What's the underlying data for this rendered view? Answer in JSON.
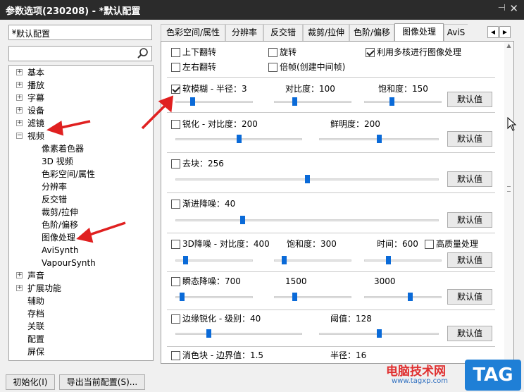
{
  "window": {
    "title": "参数选项(230208) - *默认配置"
  },
  "profile_combo": {
    "value": "*默认配置"
  },
  "tree": {
    "items": [
      {
        "label": "基本",
        "expander": "+"
      },
      {
        "label": "播放",
        "expander": "+"
      },
      {
        "label": "字幕",
        "expander": "+"
      },
      {
        "label": "设备",
        "expander": "+"
      },
      {
        "label": "滤镜",
        "expander": "+"
      },
      {
        "label": "视频",
        "expander": "−"
      },
      {
        "label": "像素着色器"
      },
      {
        "label": "3D 视频"
      },
      {
        "label": "色彩空间/属性"
      },
      {
        "label": "分辨率"
      },
      {
        "label": "反交错"
      },
      {
        "label": "裁剪/拉伸"
      },
      {
        "label": "色阶/偏移"
      },
      {
        "label": "图像处理"
      },
      {
        "label": "AviSynth"
      },
      {
        "label": "VapourSynth"
      },
      {
        "label": "声音",
        "expander": "+"
      },
      {
        "label": "扩展功能",
        "expander": "+"
      },
      {
        "label": "辅助"
      },
      {
        "label": "存档"
      },
      {
        "label": "关联"
      },
      {
        "label": "配置"
      },
      {
        "label": "屏保"
      }
    ]
  },
  "tabs": [
    {
      "label": "色彩空间/属性"
    },
    {
      "label": "分辨率"
    },
    {
      "label": "反交错"
    },
    {
      "label": "裁剪/拉伸"
    },
    {
      "label": "色阶/偏移"
    },
    {
      "label": "图像处理",
      "active": true
    },
    {
      "label": "AviS"
    }
  ],
  "top_options": {
    "flip_vertical": {
      "label": "上下翻转",
      "checked": false
    },
    "rotate": {
      "label": "旋转",
      "checked": false
    },
    "multicore": {
      "label": "利用多核进行图像处理",
      "checked": true
    },
    "flip_horizontal": {
      "label": "左右翻转",
      "checked": false
    },
    "double_frame": {
      "label": "倍帧(创建中间帧)",
      "checked": false
    }
  },
  "default_label": "默认值",
  "soft_blur": {
    "label": "软模糊 - 半径：3",
    "checked": true,
    "contrast": "对比度：100",
    "saturation": "饱和度：150",
    "radius_level": 0.2,
    "contrast_level": 0.25,
    "saturation_level": 0.35
  },
  "sharpen": {
    "label": "锐化 - 对比度：200",
    "checked": false,
    "vividness": "鲜明度：200",
    "contrast_level": 0.5,
    "vividness_level": 0.5
  },
  "deblock": {
    "label": "去块：256",
    "checked": false,
    "level": 0.5
  },
  "progressive_denoise": {
    "label": "渐进降噪：40",
    "checked": false,
    "level": 0.25
  },
  "denoise3d": {
    "label": "3D降噪 - 对比度：400",
    "checked": false,
    "saturation": "饱和度：300",
    "time": "时间：600",
    "hq_label": "高质量处理",
    "hq_checked": false,
    "contrast_level": 0.1,
    "saturation_level": 0.1,
    "time_level": 0.3
  },
  "transient_denoise": {
    "label": "瞬态降噪：700",
    "checked": false,
    "v2": "1500",
    "v3": "3000",
    "level1": 0.05,
    "level2": 0.25,
    "level3": 0.6
  },
  "edge_sharpen": {
    "label": "边缘锐化 - 级别：40",
    "checked": false,
    "threshold": "阈值：128",
    "level": 0.25,
    "threshold_level": 0.5
  },
  "deblock_edge": {
    "label": "消色块 - 边界值：1.5",
    "checked": false,
    "radius": "半径：16"
  },
  "bottom": {
    "init_button": "初始化(I)",
    "export_button": "导出当前配置(S)..."
  },
  "watermark": {
    "text": "电脑技术网",
    "url": "www.tagxp.com",
    "badge": "TAG"
  },
  "colors": {
    "accent": "#0a6ad8",
    "arrow": "#e02020",
    "titlebar": "#2b2b2b"
  }
}
